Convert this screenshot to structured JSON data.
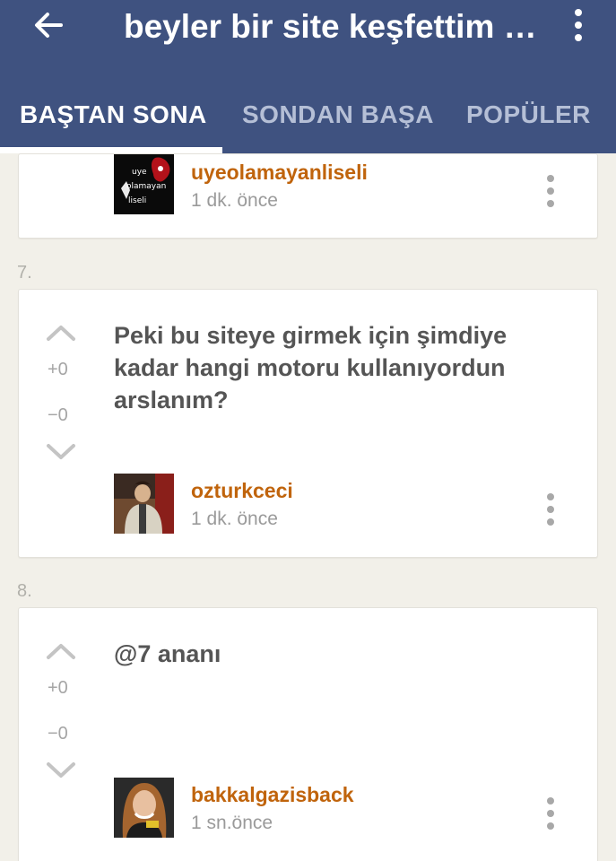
{
  "appbar": {
    "title": "beyler bir site keşfettim a...",
    "back_icon": "arrow-left-icon",
    "more_icon": "more-vertical-icon",
    "bg": "#3f5280"
  },
  "tabs": [
    {
      "label": "BAŞTAN SONA",
      "active": true
    },
    {
      "label": "SONDAN BAŞA",
      "active": false
    },
    {
      "label": "POPÜLER",
      "active": false
    }
  ],
  "entries": [
    {
      "author": "uyeolamayanliseli",
      "time": "1 dk. önce",
      "avatar_text": [
        "uye",
        "olamayan",
        "liseli"
      ]
    },
    {
      "number": "7.",
      "text": "Peki bu siteye girmek için şimdiye kadar hangi motoru kullanıyordun arslanım?",
      "plus": "+0",
      "minus": "−0",
      "author": "ozturkceci",
      "time": "1 dk. önce"
    },
    {
      "number": "8.",
      "text": "@7 ananı",
      "plus": "+0",
      "minus": "−0",
      "author": "bakkalgazisback",
      "time": "1 sn.önce"
    }
  ],
  "colors": {
    "author": "#c0640c",
    "accent": "#3f5280",
    "background": "#f2f0e9"
  }
}
